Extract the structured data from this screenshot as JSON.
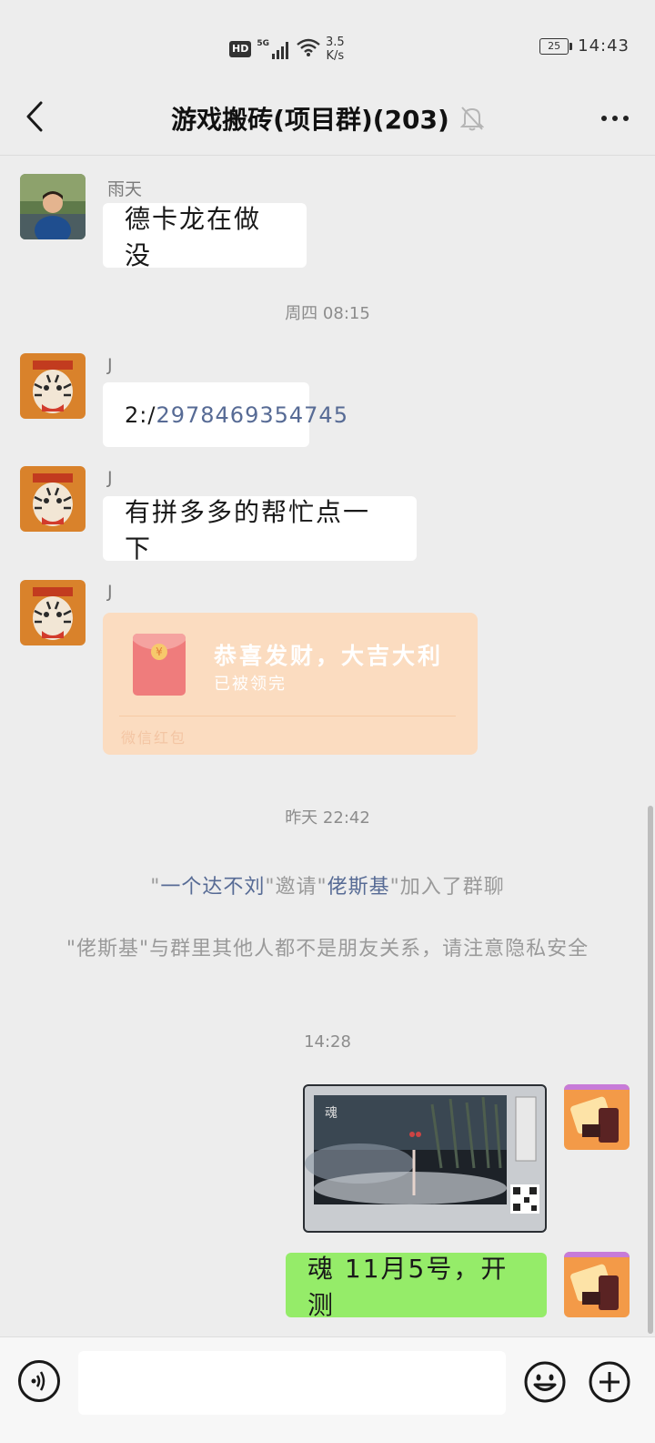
{
  "status_bar": {
    "hd": "HD",
    "signal": "5G",
    "net_speed_value": "3.5",
    "net_speed_unit": "K/s",
    "battery": "25",
    "time": "14:43"
  },
  "nav": {
    "title": "游戏搬砖(项目群)(203)",
    "back_icon": "chevron-left-icon",
    "mute_icon": "bell-off-icon",
    "more_icon": "more-dots-icon"
  },
  "messages": [
    {
      "sender": "雨天",
      "text": "德卡龙在做没"
    },
    {
      "time": "周四 08:15"
    },
    {
      "sender": "J",
      "prefix": "2:/",
      "link": "2978469354745"
    },
    {
      "sender": "J",
      "text": "有拼多多的帮忙点一下"
    },
    {
      "sender": "J",
      "red_packet": {
        "title": "恭喜发财，大吉大利",
        "status": "已被领完",
        "footer": "微信红包"
      }
    },
    {
      "time": "昨天 22:42"
    },
    {
      "system": {
        "inviter": "一个达不刘",
        "verb": "邀请",
        "invitee": "佬斯基",
        "suffix": "加入了群聊"
      }
    },
    {
      "system2": {
        "name": "佬斯基",
        "text": "与群里其他人都不是朋友关系，请注意隐私安全"
      }
    },
    {
      "time": "14:28"
    },
    {
      "self_image": true
    },
    {
      "self_text": "魂 11月5号，开测"
    }
  ],
  "colors": {
    "background": "#ededed",
    "self_bubble": "#95ec69",
    "red_packet": "#fbdcc0",
    "link": "#576b95"
  },
  "input_bar": {
    "voice_icon": "voice-icon",
    "emoji_icon": "emoji-icon",
    "plus_icon": "plus-icon",
    "value": ""
  }
}
